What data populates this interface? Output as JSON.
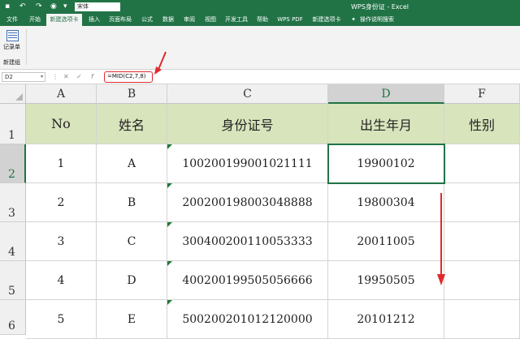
{
  "titlebar": {
    "font_box": "宋体",
    "title": "WPS身份证 - Excel"
  },
  "menu": {
    "items": [
      "文件",
      "开始",
      "新建选项卡",
      "插入",
      "页面布局",
      "公式",
      "数据",
      "审阅",
      "视图",
      "开发工具",
      "帮助",
      "WPS PDF",
      "新建选项卡"
    ],
    "active_index": 2,
    "search_label": "操作说明搜索"
  },
  "ribbon": {
    "button_label": "记录单",
    "group_label": "新建组"
  },
  "formula_bar": {
    "name_box": "D2",
    "formula": "=MID(C2,7,8)"
  },
  "sheet": {
    "columns": [
      "A",
      "B",
      "C",
      "D",
      "F"
    ],
    "selected_column": "D",
    "rows": [
      "1",
      "2",
      "3",
      "4",
      "5",
      "6"
    ],
    "selected_row": "2",
    "header": [
      "No",
      "姓名",
      "身份证号",
      "出生年月",
      "性别"
    ],
    "data": [
      [
        "1",
        "A",
        "100200199001021111",
        "19900102",
        ""
      ],
      [
        "2",
        "B",
        "200200198003048888",
        "19800304",
        ""
      ],
      [
        "3",
        "C",
        "300400200110053333",
        "20011005",
        ""
      ],
      [
        "4",
        "D",
        "400200199505056666",
        "19950505",
        ""
      ],
      [
        "5",
        "E",
        "500200201012120000",
        "20101212",
        ""
      ]
    ],
    "active_cell": "D2"
  },
  "colors": {
    "brand": "#217346",
    "header_fill": "#d8e4bc",
    "annotation": "#e02a2a"
  }
}
